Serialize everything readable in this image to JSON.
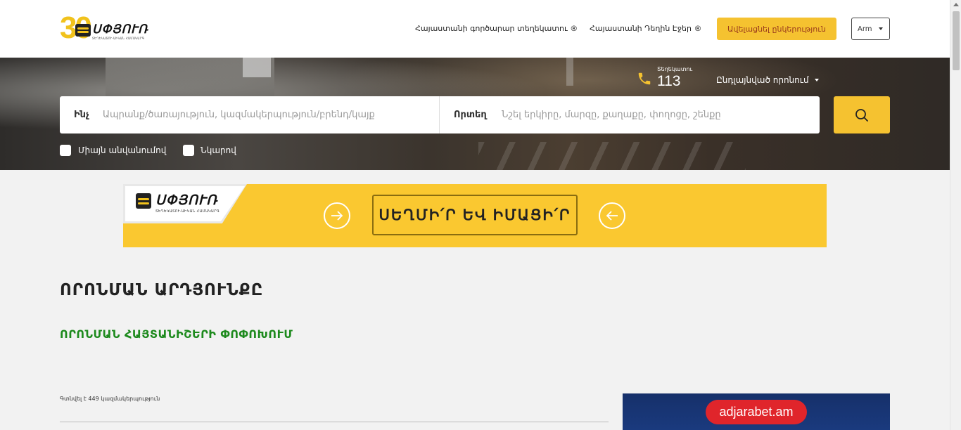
{
  "header": {
    "logo_anniversary": "30",
    "logo_brand": "ՍՓՅՈՒՌ",
    "logo_tagline": "ՏԵՂԵԿԱՏՈՒ-ԱԻԿԱՆ ՀԱՄԱԿԱՐԳ",
    "nav_links": [
      "Հայաստանի գործարար տեղեկատու ®",
      "Հայաստանի Դեղին Էջեր ®"
    ],
    "add_company_label": "Ավելացնել ընկերություն",
    "language": "Arm"
  },
  "hero": {
    "info_label": "Տեղեկատու",
    "info_number": "113",
    "advanced_search_label": "Ընդլայնված որոնում",
    "search": {
      "what_label": "Ինչ",
      "what_placeholder": "Ապրանք/ծառայություն, կազմակերպություն/բրենդ/կայք",
      "where_label": "Որտեղ",
      "where_placeholder": "Նշել երկիրը, մարզը, քաղաքը, փողոցը, շենքը"
    },
    "checkboxes": [
      {
        "label": "Միայն անվանումով",
        "checked": false
      },
      {
        "label": "Նկարով",
        "checked": false
      }
    ]
  },
  "banner": {
    "brand": "ՍՓՅՈՒՌ",
    "tagline": "ՏԵՂԵԿԱՏՈՒ-ԱԻԿԱՆ ՀԱՄԱԿԱՐԳ",
    "cta": "ՍԵՂՄԻ՛Ր ԵՎ ԻՄԱՑԻ՛Ր"
  },
  "results": {
    "title": "ՈՐՈՆՄԱՆ ԱՐԴՅՈՒՆՔԸ",
    "change_link": "ՈՐՈՆՄԱՆ ՀԱՅՏԱՆԻՇԵՐԻ ՓՈՓՈԽՈՒՄ",
    "found_text": "Գտնվել է 449 կազմակերպություն"
  },
  "ad": {
    "text": "adjarabet.am"
  },
  "colors": {
    "accent_yellow": "#f5c230",
    "link_green": "#1d8a1d",
    "cta_text": "#9b3b1c"
  }
}
